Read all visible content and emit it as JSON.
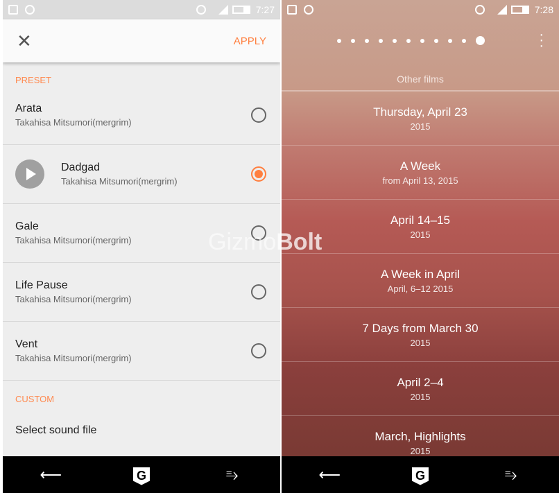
{
  "left": {
    "status": {
      "time": "7:27"
    },
    "toolbar": {
      "close_icon": "close-icon",
      "apply": "APPLY"
    },
    "preset_header": "PRESET",
    "presets": [
      {
        "title": "Arata",
        "subtitle": "Takahisa Mitsumori(mergrim)",
        "selected": false
      },
      {
        "title": "Dadgad",
        "subtitle": "Takahisa Mitsumori(mergrim)",
        "selected": true
      },
      {
        "title": "Gale",
        "subtitle": "Takahisa Mitsumori(mergrim)",
        "selected": false
      },
      {
        "title": "Life Pause",
        "subtitle": "Takahisa Mitsumori(mergrim)",
        "selected": false
      },
      {
        "title": "Vent",
        "subtitle": "Takahisa Mitsumori(mergrim)",
        "selected": false
      }
    ],
    "custom_header": "CUSTOM",
    "select_sound": "Select sound file"
  },
  "right": {
    "status": {
      "time": "7:28"
    },
    "page_count": 11,
    "active_page": 11,
    "other_films": "Other films",
    "films": [
      {
        "title": "Thursday, April 23",
        "subtitle": "2015"
      },
      {
        "title": "A Week",
        "subtitle": "from April 13, 2015"
      },
      {
        "title": "April 14–15",
        "subtitle": "2015"
      },
      {
        "title": "A Week in April",
        "subtitle": "April, 6–12 2015"
      },
      {
        "title": "7 Days from March 30",
        "subtitle": "2015"
      },
      {
        "title": "April 2–4",
        "subtitle": "2015"
      },
      {
        "title": "March, Highlights",
        "subtitle": "2015"
      }
    ]
  },
  "watermark": {
    "part1": "Gizmo",
    "part2": "Bolt"
  },
  "colors": {
    "accent": "#ff7f3f",
    "navbar": "#000000"
  }
}
